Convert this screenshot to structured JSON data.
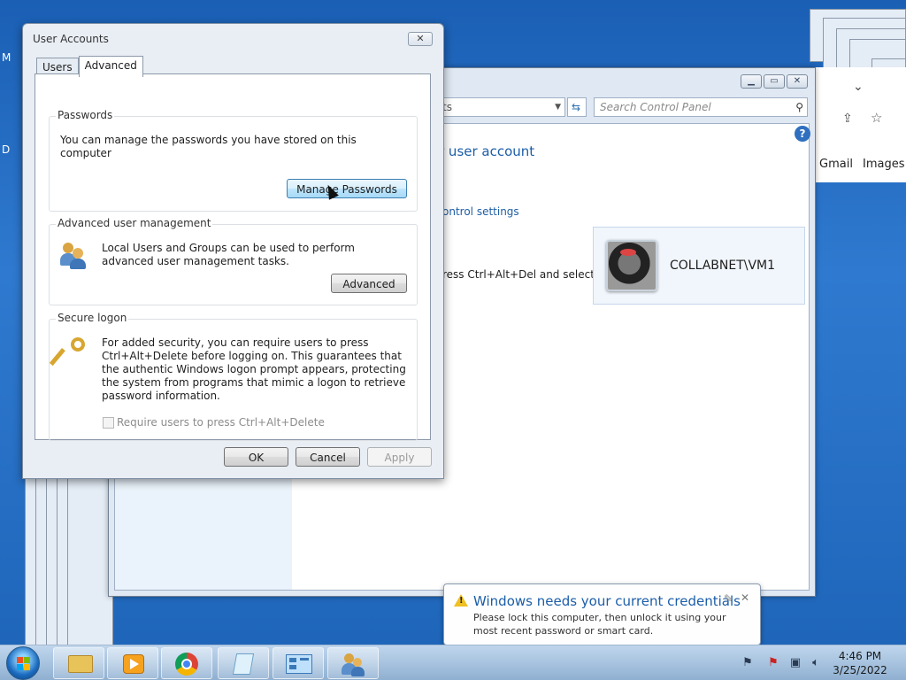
{
  "dialog": {
    "title": "User Accounts",
    "close_symbol": "✕",
    "tabs": [
      {
        "label": "Users",
        "selected": false
      },
      {
        "label": "Advanced",
        "selected": true
      }
    ],
    "passwords": {
      "heading": "Passwords",
      "text": "You can manage the passwords you have stored on this computer",
      "button": "Manage Passwords"
    },
    "advanced_mgmt": {
      "heading": "Advanced user management",
      "text": "Local Users and Groups can be used to perform advanced user management tasks.",
      "button": "Advanced",
      "icon": "users-icon"
    },
    "secure_logon": {
      "heading": "Secure logon",
      "text": "For added security, you can require users to press Ctrl+Alt+Delete before logging on. This guarantees that the authentic Windows logon prompt appears, protecting the system from programs that mimic a logon to retrieve password information.",
      "checkbox_label": "Require users to press Ctrl+Alt+Delete",
      "checkbox_checked": false,
      "checkbox_enabled": false,
      "icon": "key-icon"
    },
    "buttons": {
      "ok": "OK",
      "cancel": "Cancel",
      "apply": "Apply"
    }
  },
  "control_panel": {
    "address_fragment": "ts",
    "search_placeholder": "Search Control Panel",
    "heading_fragment": "r user account",
    "link_fragment": "ontrol settings",
    "instruction_fragment": "ress Ctrl+Alt+Del and select Change a password.",
    "user_name": "COLLABNET\\VM1"
  },
  "browser": {
    "links": [
      "Gmail",
      "Images"
    ]
  },
  "desktop_fragments": [
    "M",
    "D"
  ],
  "notification": {
    "title": "Windows needs your current credentials",
    "body": "Please lock this computer, then unlock it using your most recent password or smart card.",
    "icon": "warning-icon"
  },
  "taskbar": {
    "apps": [
      "file-explorer-icon",
      "media-player-icon",
      "chrome-icon",
      "notepad-icon",
      "control-panel-icon",
      "user-accounts-icon"
    ],
    "time": "4:46 PM",
    "date": "3/25/2022"
  },
  "colors": {
    "accent_title": "#1c5ea8",
    "link": "#1f5fa6"
  }
}
